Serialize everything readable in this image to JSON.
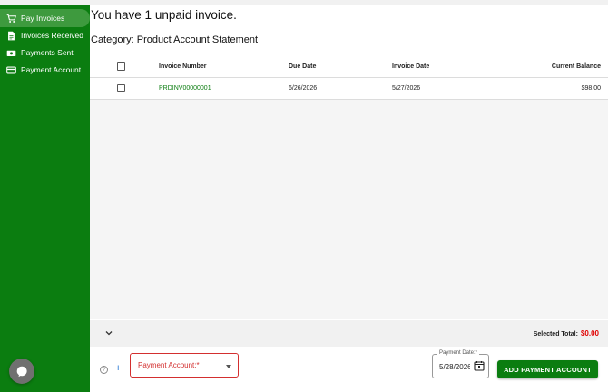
{
  "sidebar": {
    "items": [
      {
        "label": "Pay Invoices",
        "icon": "cart-icon",
        "active": true
      },
      {
        "label": "Invoices Received",
        "icon": "document-icon",
        "active": false
      },
      {
        "label": "Payments Sent",
        "icon": "money-icon",
        "active": false
      },
      {
        "label": "Payment Account",
        "icon": "credit-card-icon",
        "active": false
      }
    ],
    "chat_icon": "chat-bubble-icon"
  },
  "main": {
    "headline": "You have 1 unpaid invoice.",
    "category": "Category: Product Account Statement",
    "table": {
      "columns": [
        "Invoice Number",
        "Due Date",
        "Invoice Date",
        "Current Balance"
      ],
      "rows": [
        {
          "invoice_number": "PRDINV00000001",
          "due_date": "6/26/2026",
          "invoice_date": "5/27/2026",
          "current_balance": "$98.00"
        }
      ]
    }
  },
  "footer": {
    "selected_total_label": "Selected Total:",
    "selected_total_value": "$0.00",
    "payment_account_label": "Payment Account:",
    "required_mark": "*",
    "payment_date_label": "Payment Date:*",
    "payment_date_value": "5/28/2026",
    "add_button_label": "ADD PAYMENT ACCOUNT",
    "help_glyph": "?",
    "plus_glyph": "+"
  },
  "colors": {
    "brand_green": "#0b7d10",
    "active_nav": "#3e9a3e",
    "error_red": "#d32f2f",
    "total_red": "#e00000",
    "link_blue": "#1a6fd1"
  }
}
